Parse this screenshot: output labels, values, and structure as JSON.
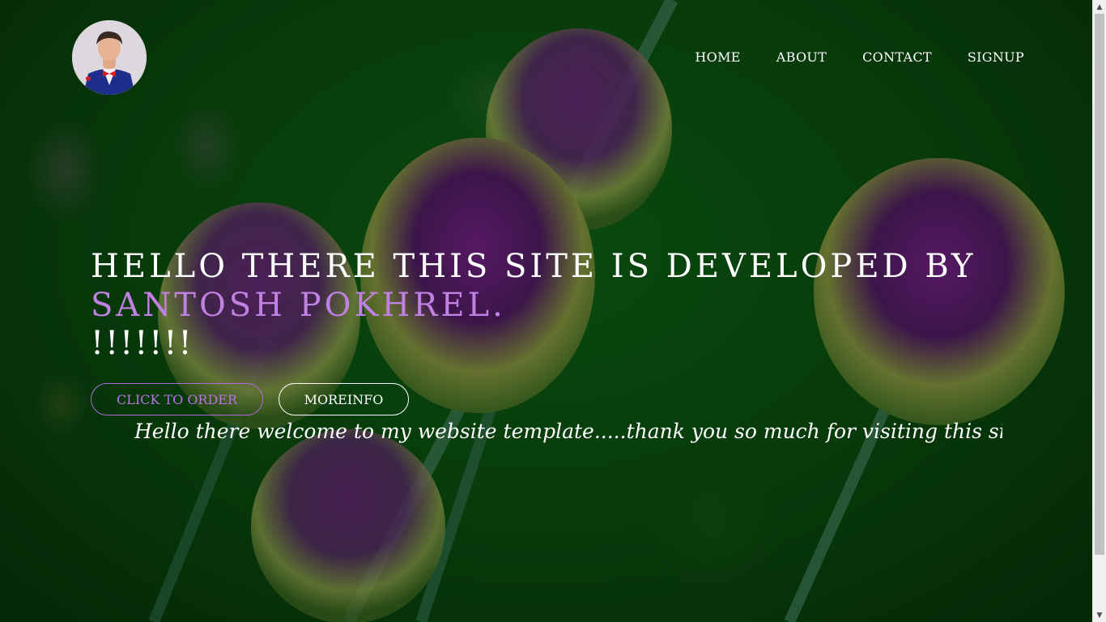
{
  "nav": {
    "items": [
      "HOME",
      "ABOUT",
      "CONTACT",
      "SIGNUP"
    ]
  },
  "hero": {
    "line1": "HELLO THERE THIS SITE IS DEVELOPED BY",
    "line2": "SANTOSH POKHREL.",
    "line3": "!!!!!!!",
    "accent_color": "#c081e3"
  },
  "buttons": {
    "order_label": "CLICK TO ORDER",
    "more_label": "MOREINFO"
  },
  "marquee": {
    "text": "Hello there welcome to my website template.....thank you so much for visiting this site...if yo"
  },
  "icons": {
    "avatar": "profile-photo",
    "scroll_up": "triangle-up-icon",
    "scroll_down": "triangle-down-icon"
  }
}
